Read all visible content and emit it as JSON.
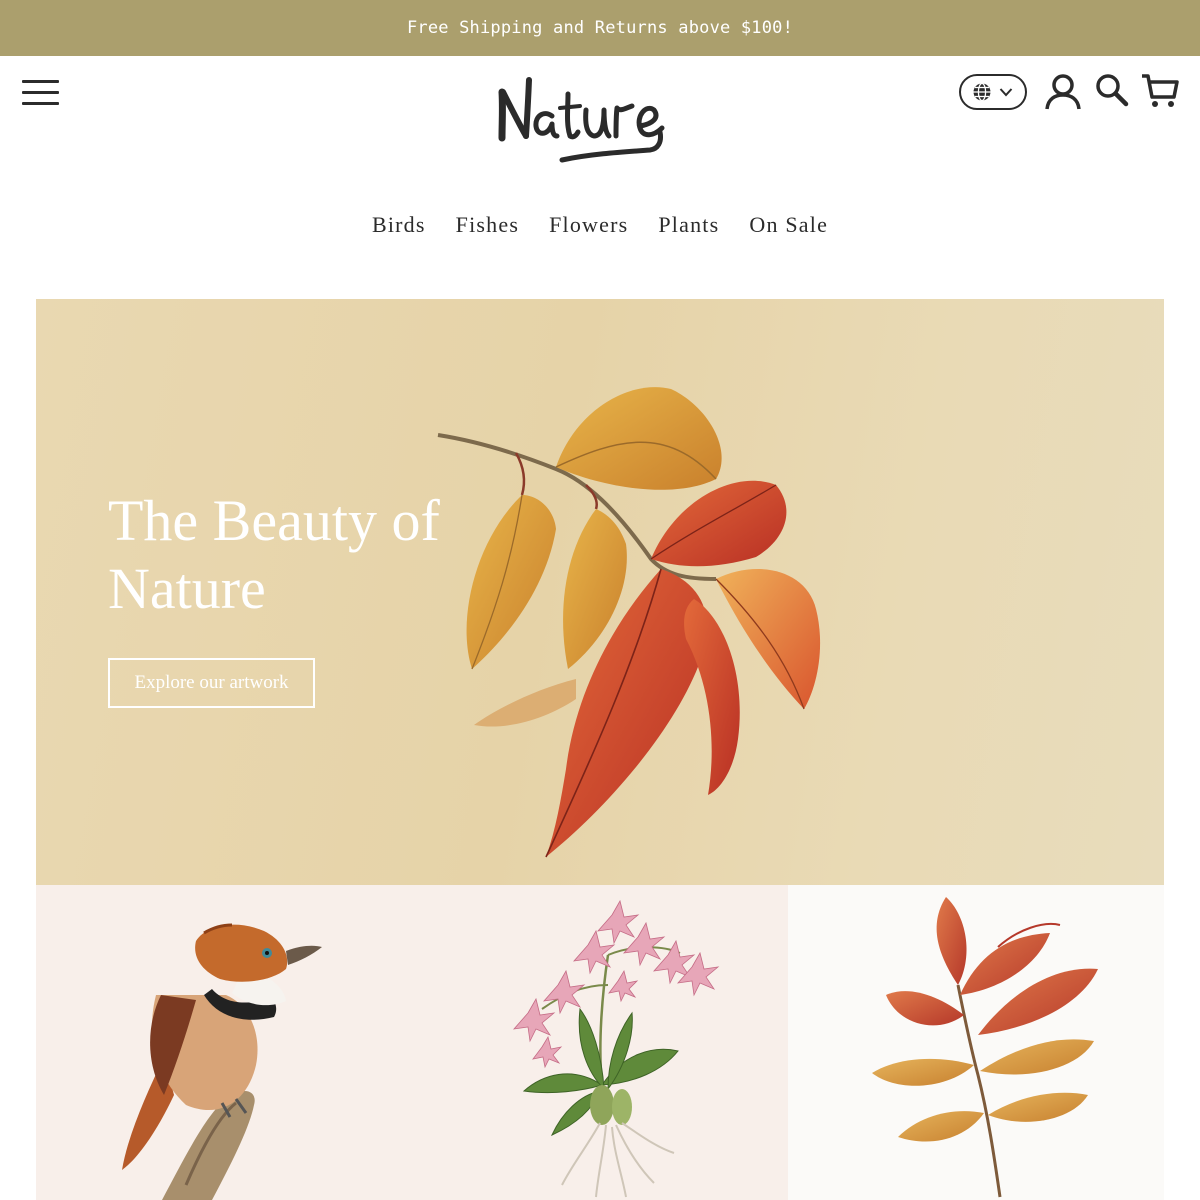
{
  "announcement": {
    "text": "Free Shipping and Returns above $100!"
  },
  "header": {
    "logo_text": "Nature",
    "icons": {
      "menu": "hamburger-menu-icon",
      "locale": "globe-icon",
      "account": "user-icon",
      "search": "search-icon",
      "cart": "cart-icon"
    }
  },
  "nav": {
    "items": [
      {
        "label": "Birds"
      },
      {
        "label": "Fishes"
      },
      {
        "label": "Flowers"
      },
      {
        "label": "Plants"
      },
      {
        "label": "On Sale"
      }
    ]
  },
  "hero": {
    "title_line1": "The Beauty of",
    "title_line2": "Nature",
    "button_label": "Explore our artwork"
  },
  "colors": {
    "announcement_bg": "#ab9f6d",
    "hero_bg": "#e6d3a8",
    "tile_bg": "#f8efea",
    "text": "#2b2b2b"
  }
}
